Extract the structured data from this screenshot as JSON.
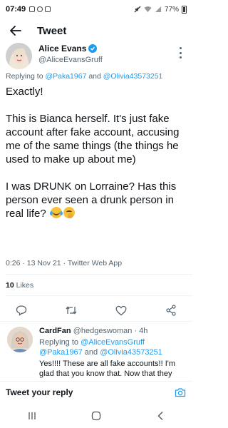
{
  "status_bar": {
    "time": "07:49",
    "battery": "77%"
  },
  "header": {
    "title": "Tweet"
  },
  "tweet": {
    "author_name": "Alice Evans",
    "author_handle": "@AliceEvansGruff",
    "replying_prefix": "Replying to ",
    "replying_to_1": "@Paka1967",
    "replying_and": " and ",
    "replying_to_2": "@Olivia43573251",
    "text_lines": [
      "Exactly!",
      "This is Bianca herself. It's just fake account after fake account, accusing me of the same things (the things he used to make up about me)",
      "I was DRUNK on Lorraine? Has this person ever seen a drunk person in real life?"
    ],
    "time": "0:26",
    "date": "13 Nov 21",
    "source": "Twitter Web App",
    "meta_sep": " · ",
    "likes_count": "10",
    "likes_label": " Likes"
  },
  "reply": {
    "name": "CardFan",
    "handle": "@hedgeswoman",
    "sep": " · ",
    "age": "4h",
    "replying_prefix": "Replying to ",
    "replying_to_1": "@AliceEvansGruff",
    "replying_to_2": "@Paka1967",
    "replying_and": " and ",
    "replying_to_3": "@Olivia43573251",
    "text": "Yes!!!! These are all fake accounts!! I'm glad that you know that. Now that they"
  },
  "compose": {
    "placeholder": "Tweet your reply"
  },
  "icons": {
    "accent": "#1d9bf0",
    "muted": "#536471"
  }
}
